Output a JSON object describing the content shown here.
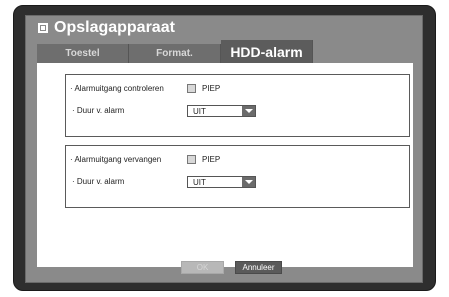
{
  "window": {
    "title": "Opslagapparaat"
  },
  "tabs": [
    {
      "label": "Toestel"
    },
    {
      "label": "Format."
    },
    {
      "label": "HDD-alarm"
    }
  ],
  "groups": [
    {
      "check_row_label": "· Alarmuitgang controleren",
      "checkbox_label": "PIEP",
      "duration_label": "· Duur v. alarm",
      "duration_value": "UIT"
    },
    {
      "check_row_label": "· Alarmuitgang vervangen",
      "checkbox_label": "PIEP",
      "duration_label": "· Duur v. alarm",
      "duration_value": "UIT"
    }
  ],
  "buttons": {
    "ok": "OK",
    "cancel": "Annuleer"
  },
  "colors": {
    "frame": "#2e2e2e",
    "panel": "#8a8a8a",
    "tab_active": "#5c5c5c",
    "tab_inactive": "#6e6e6e"
  }
}
